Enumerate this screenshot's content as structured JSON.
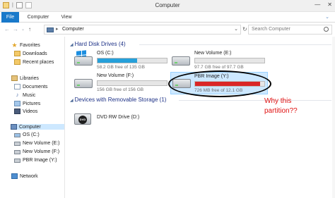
{
  "window": {
    "title": "Computer",
    "minimize": "—",
    "close": "✕"
  },
  "quick_access": {
    "separator": "|"
  },
  "ribbon": {
    "tabs": [
      "File",
      "Computer",
      "View"
    ],
    "expand_glyph": "⌄"
  },
  "address": {
    "back": "←",
    "forward": "→",
    "recent": "⌄",
    "up": "↑",
    "chevron": "▸",
    "path": "Computer",
    "dropdown": "⌄",
    "refresh": "↻"
  },
  "search": {
    "placeholder": "Search Computer"
  },
  "nav": {
    "favorites": "Favorites",
    "downloads": "Downloads",
    "recent_places": "Recent places",
    "libraries": "Libraries",
    "documents": "Documents",
    "music": "Music",
    "pictures": "Pictures",
    "videos": "Videos",
    "computer": "Computer",
    "os_c": "OS (C:)",
    "volume_e": "New Volume (E:)",
    "volume_f": "New Volume (F:)",
    "pbr_y": "PBR Image (Y:)",
    "network": "Network"
  },
  "groups": {
    "hard_disks": "Hard Disk Drives (4)",
    "removable": "Devices with Removable Storage (1)"
  },
  "drives": [
    {
      "name": "OS (C:)",
      "free": "58.2 GB free of 135 GB",
      "used_fraction": 0.57
    },
    {
      "name": "New Volume (E:)",
      "free": "97.7 GB free of 97.7 GB",
      "used_fraction": 0.0
    },
    {
      "name": "New Volume (F:)",
      "free": "156 GB free of 156 GB",
      "used_fraction": 0.0
    },
    {
      "name": "PBR Image (Y:)",
      "free": "726 MB free of 12.1 GB",
      "used_fraction": 0.94
    }
  ],
  "dvd": {
    "name": "DVD RW Drive (D:)",
    "disc_label": "DVD"
  },
  "annotation": {
    "line1": "Why this",
    "line2": "partition??"
  },
  "colors": {
    "file_tab": "#1979ca",
    "bar_normal": "#26a0da",
    "bar_low": "#da2626",
    "annotation": "#e01010",
    "selection": "#cde8ff"
  }
}
